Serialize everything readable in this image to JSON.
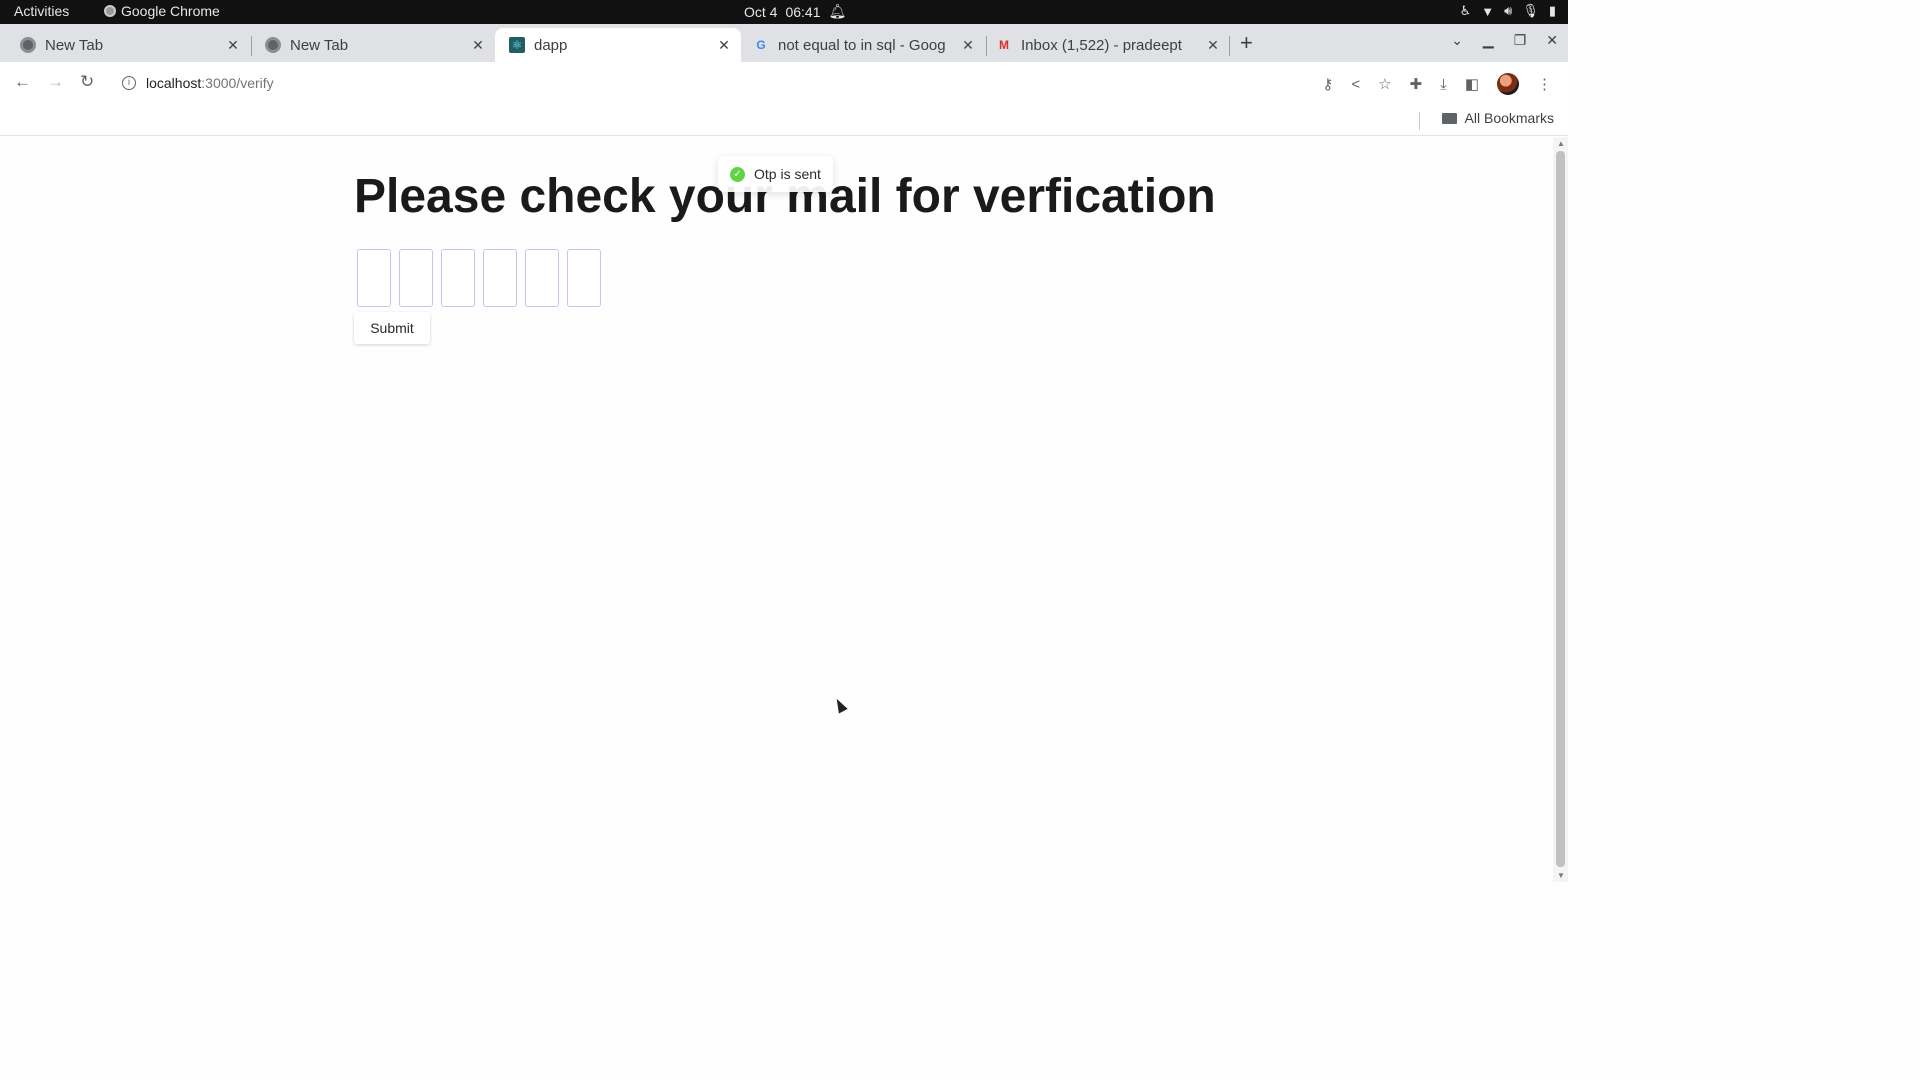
{
  "system_bar": {
    "activities": "Activities",
    "app_name": "Google Chrome",
    "date": "Oct 4",
    "time": "06:41"
  },
  "tabs": [
    {
      "title": "New Tab",
      "favicon": "chrome-icon",
      "active": false
    },
    {
      "title": "New Tab",
      "favicon": "chrome-icon",
      "active": false
    },
    {
      "title": "dapp",
      "favicon": "react-icon",
      "active": true
    },
    {
      "title": "not equal to in sql - Goog",
      "favicon": "google-icon",
      "active": false
    },
    {
      "title": "Inbox (1,522) - pradeept",
      "favicon": "gmail-icon",
      "active": false
    }
  ],
  "omnibox": {
    "host": "localhost",
    "path": ":3000/verify"
  },
  "bookmarks_bar": {
    "all_bookmarks": "All Bookmarks"
  },
  "page": {
    "heading": "Please check your mail for verfication",
    "otp_boxes": [
      "",
      "",
      "",
      "",
      "",
      ""
    ],
    "submit_label": "Submit",
    "toast_text": "Otp is sent"
  },
  "colors": {
    "otp_border": "#c9c4ee",
    "toast_success": "#61d345",
    "tabstrip_bg": "#dfe1e5"
  }
}
